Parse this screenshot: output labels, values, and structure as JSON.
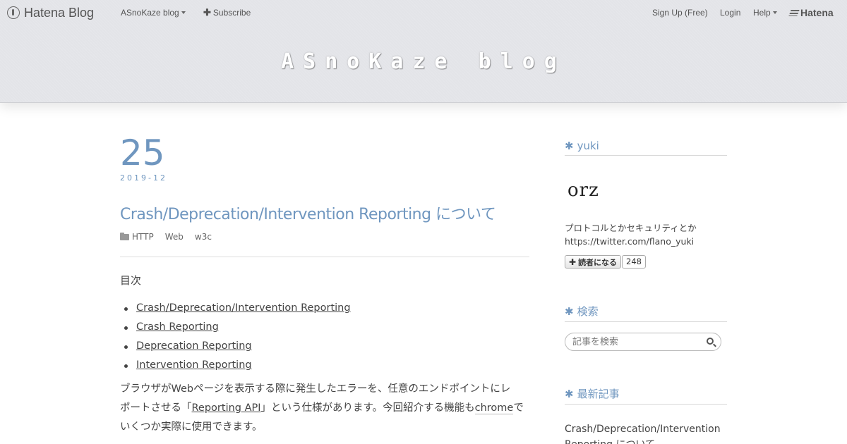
{
  "globalheader": {
    "logo": "Hatena Blog",
    "blog_menu": "ASnoKaze blog",
    "subscribe": "Subscribe",
    "signup": "Sign Up (Free)",
    "login": "Login",
    "help": "Help",
    "hatena": "Hatena"
  },
  "blog": {
    "title": "ASnoKaze blog"
  },
  "entry": {
    "day": "25",
    "year_month": "2019-12",
    "title": "Crash/Deprecation/Intervention Reporting について",
    "categories": [
      "HTTP",
      "Web",
      "w3c"
    ],
    "toc_title": "目次",
    "toc": [
      "Crash/Deprecation/Intervention Reporting",
      "Crash Reporting",
      "Deprecation Reporting",
      "Intervention Reporting"
    ],
    "para": {
      "line1": "ブラウザがWebページを表示する際に発生したエラーを、任意のエンドポイントにレ",
      "line2_a": "ポートさせる「",
      "line2_link": "Reporting API",
      "line2_b": "」という仕様があります。今回紹介する機能も",
      "line2_klink": "chrome",
      "line2_c": "で",
      "line3": "いくつか実際に使用できます。"
    }
  },
  "sidebar": {
    "profile": {
      "title": "yuki",
      "icon_text": "orz",
      "desc": "プロトコルとかセキュリティとか",
      "url": "https://twitter.com/flano_yuki",
      "reader_button": "読者になる",
      "reader_count": "248"
    },
    "search": {
      "title": "検索",
      "placeholder": "記事を検索"
    },
    "recent": {
      "title": "最新記事",
      "items": [
        "Crash/Deprecation/Intervention Reporting について"
      ]
    }
  },
  "colors": {
    "accent": "#6f96bf",
    "header_bg": "#e3e4e8",
    "text": "#444444"
  },
  "icons": {
    "logo": "hatena-blog-logo-icon",
    "subscribe": "plus-icon",
    "category": "folder-icon",
    "search": "search-icon",
    "module": "star-icon"
  }
}
